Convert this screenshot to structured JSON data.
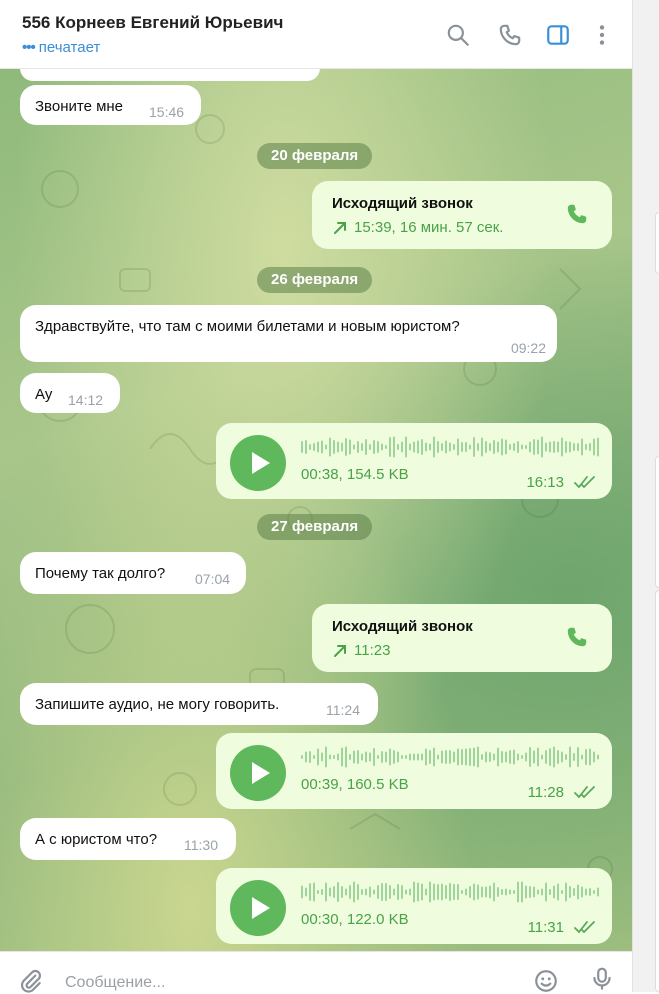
{
  "header": {
    "title": "556 Корнеев Евгений Юрьевич",
    "status": "печатает",
    "icons": [
      "search-icon",
      "phone-icon",
      "sidebar-toggle-icon",
      "more-icon"
    ]
  },
  "messages": {
    "m1": {
      "text": "Звоните мне",
      "time": "15:46"
    },
    "d1": "20 февраля",
    "c1": {
      "title": "Исходящий звонок",
      "meta": "15:39, 16 мин. 57 сек."
    },
    "d2": "26 февраля",
    "m2": {
      "text": "Здравствуйте, что там с моими билетами и новым юристом?",
      "time": "09:22"
    },
    "m3": {
      "text": "Ау",
      "time": "14:12"
    },
    "v1": {
      "meta": "00:38, 154.5 KB",
      "time": "16:13"
    },
    "d3": "27 февраля",
    "m4": {
      "text": "Почему так долго?",
      "time": "07:04"
    },
    "c2": {
      "title": "Исходящий звонок",
      "meta": "11:23"
    },
    "m5": {
      "text": "Запишите аудио, не могу говорить.",
      "time": "11:24"
    },
    "v2": {
      "meta": "00:39, 160.5 KB",
      "time": "11:28"
    },
    "m6": {
      "text": "А с юристом что?",
      "time": "11:30"
    },
    "v3": {
      "meta": "00:30, 122.0 KB",
      "time": "11:31"
    }
  },
  "input": {
    "placeholder": "Сообщение..."
  },
  "colors": {
    "accent": "#3a8fd6",
    "outgoing": "#effdde",
    "green": "#49a248",
    "play": "#5fb85b"
  }
}
